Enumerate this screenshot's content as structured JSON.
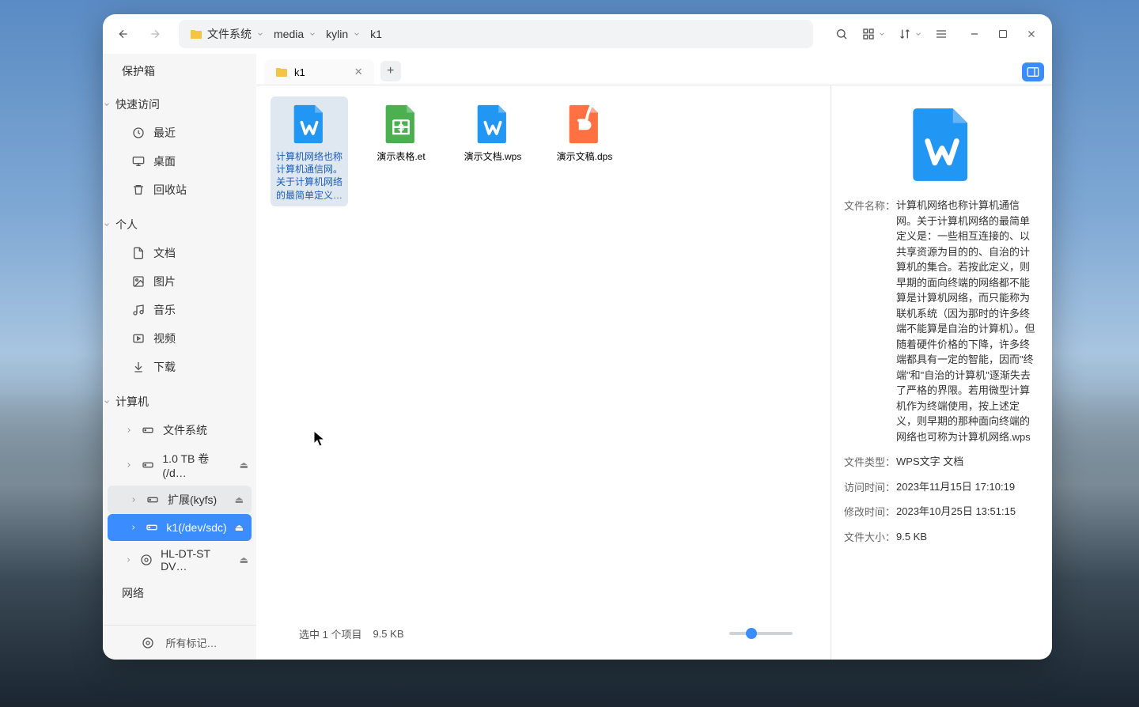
{
  "sidebar": {
    "top_title": "保护箱",
    "quick_header": "快速访问",
    "quick_items": [
      {
        "icon": "clock",
        "label": "最近"
      },
      {
        "icon": "monitor",
        "label": "桌面"
      },
      {
        "icon": "trash",
        "label": "回收站"
      }
    ],
    "personal_header": "个人",
    "personal_items": [
      {
        "icon": "doc",
        "label": "文档"
      },
      {
        "icon": "picture",
        "label": "图片"
      },
      {
        "icon": "music",
        "label": "音乐"
      },
      {
        "icon": "video",
        "label": "视频"
      },
      {
        "icon": "download",
        "label": "下载"
      }
    ],
    "computer_header": "计算机",
    "computer_items": [
      {
        "icon": "disk",
        "label": "文件系统",
        "eject": false
      },
      {
        "icon": "disk",
        "label": "1.0 TB 卷(/d…",
        "eject": true
      },
      {
        "icon": "disk",
        "label": "扩展(kyfs)",
        "eject": true,
        "hover": true
      },
      {
        "icon": "disk",
        "label": "k1(/dev/sdc)",
        "eject": true,
        "selected": true
      },
      {
        "icon": "optical",
        "label": "HL-DT-ST DV…",
        "eject": true
      }
    ],
    "network_label": "网络",
    "bottom_label": "所有标记…"
  },
  "breadcrumb": [
    {
      "label": "文件系统",
      "has_folder": true
    },
    {
      "label": "media"
    },
    {
      "label": "kylin"
    },
    {
      "label": "k1",
      "no_chevron": true
    }
  ],
  "tab": {
    "name": "k1"
  },
  "files": [
    {
      "type": "wps-blue",
      "label": "计算机网络也称计算机通信网。关于计算机网络的最简单定义…",
      "selected": true
    },
    {
      "type": "et-green",
      "label": "演示表格.et"
    },
    {
      "type": "wps-blue",
      "label": "演示文档.wps"
    },
    {
      "type": "dps-orange",
      "label": "演示文稿.dps"
    }
  ],
  "details": {
    "name_label": "文件名称：",
    "name_value": "计算机网络也称计算机通信网。关于计算机网络的最简单定义是：一些相互连接的、以共享资源为目的的、自治的计算机的集合。若按此定义，则早期的面向终端的网络都不能算是计算机网络，而只能称为联机系统（因为那时的许多终端不能算是自治的计算机）。但随着硬件价格的下降，许多终端都具有一定的智能，因而\"终端\"和\"自治的计算机\"逐渐失去了严格的界限。若用微型计算机作为终端使用，按上述定义，则早期的那种面向终端的网络也可称为计算机网络.wps",
    "type_label": "文件类型：",
    "type_value": "WPS文字 文档",
    "access_label": "访问时间：",
    "access_value": "2023年11月15日 17:10:19",
    "mod_label": "修改时间：",
    "mod_value": "2023年10月25日 13:51:15",
    "size_label": "文件大小：",
    "size_value": "9.5 KB"
  },
  "status": {
    "selection_text": "选中 1 个项目",
    "size_text": "9.5 KB"
  }
}
